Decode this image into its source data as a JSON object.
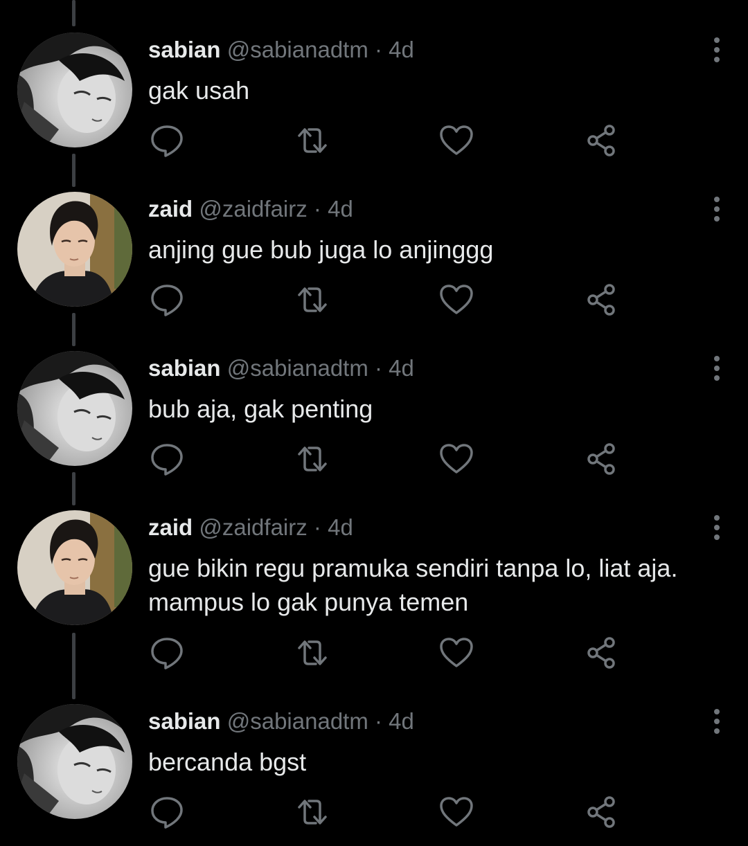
{
  "colors": {
    "background": "#000000",
    "text": "#e7e9ea",
    "secondary": "#71767b",
    "thread_line": "#3c3f43"
  },
  "tweets": [
    {
      "name": "sabian",
      "handle": "@sabianadtm",
      "separator": "·",
      "time": "4d",
      "text": "gak usah",
      "avatar": "sabian-avatar"
    },
    {
      "name": "zaid",
      "handle": "@zaidfairz",
      "separator": "·",
      "time": "4d",
      "text": "anjing gue bub juga lo anjinggg",
      "avatar": "zaid-avatar"
    },
    {
      "name": "sabian",
      "handle": "@sabianadtm",
      "separator": "·",
      "time": "4d",
      "text": "bub aja, gak penting",
      "avatar": "sabian-avatar"
    },
    {
      "name": "zaid",
      "handle": "@zaidfairz",
      "separator": "·",
      "time": "4d",
      "text": "gue bikin regu pramuka sendiri tanpa lo, liat aja. mampus lo gak punya temen",
      "avatar": "zaid-avatar"
    },
    {
      "name": "sabian",
      "handle": "@sabianadtm",
      "separator": "·",
      "time": "4d",
      "text": "bercanda bgst",
      "avatar": "sabian-avatar"
    }
  ],
  "action_icons": [
    "reply-icon",
    "retweet-icon",
    "like-icon",
    "share-icon"
  ],
  "menu_icon": "more-options-icon"
}
